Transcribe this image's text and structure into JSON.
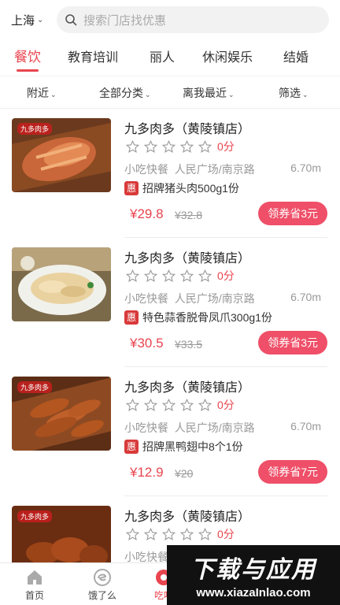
{
  "header": {
    "city": "上海",
    "search_placeholder": "搜索门店找优惠"
  },
  "tabs": [
    {
      "label": "餐饮",
      "active": true
    },
    {
      "label": "教育培训"
    },
    {
      "label": "丽人"
    },
    {
      "label": "休闲娱乐"
    },
    {
      "label": "结婚"
    }
  ],
  "filters": [
    {
      "label": "附近"
    },
    {
      "label": "全部分类"
    },
    {
      "label": "离我最近"
    },
    {
      "label": "筛选"
    }
  ],
  "deals": [
    {
      "store": "九多肉多（黄陵镇店）",
      "rating_stars": 0,
      "score": "0分",
      "category": "小吃快餐",
      "area": "人民广场/南京路",
      "distance": "6.70m",
      "badge": "惠",
      "item": "招牌猪头肉500g1份",
      "price": "¥29.8",
      "original_price": "¥32.8",
      "coupon": "领券省3元",
      "brand_tag": "九多肉多"
    },
    {
      "store": "九多肉多（黄陵镇店）",
      "rating_stars": 0,
      "score": "0分",
      "category": "小吃快餐",
      "area": "人民广场/南京路",
      "distance": "6.70m",
      "badge": "惠",
      "item": "特色蒜香脱骨凤爪300g1份",
      "price": "¥30.5",
      "original_price": "¥33.5",
      "coupon": "领券省3元",
      "brand_tag": ""
    },
    {
      "store": "九多肉多（黄陵镇店）",
      "rating_stars": 0,
      "score": "0分",
      "category": "小吃快餐",
      "area": "人民广场/南京路",
      "distance": "6.70m",
      "badge": "惠",
      "item": "招牌黑鸭翅中8个1份",
      "price": "¥12.9",
      "original_price": "¥20",
      "coupon": "领券省7元",
      "brand_tag": "九多肉多"
    },
    {
      "store": "九多肉多（黄陵镇店）",
      "rating_stars": 0,
      "score": "0分",
      "category": "小吃快餐",
      "area": "",
      "distance": "",
      "badge": "",
      "item": "",
      "price": "",
      "original_price": "",
      "coupon": "",
      "brand_tag": "九多肉多"
    }
  ],
  "bottom_nav": [
    {
      "label": "首页",
      "icon": "home-icon"
    },
    {
      "label": "饿了么",
      "icon": "eleme-icon"
    },
    {
      "label": "吃喝",
      "icon": "food-icon",
      "active": true
    }
  ],
  "watermark": {
    "big": "下载与应用",
    "small": "www.xiazaInlao.com"
  },
  "colors": {
    "accent": "#e8454f",
    "coupon": "#ef4f68",
    "badge": "#d93a3a"
  }
}
